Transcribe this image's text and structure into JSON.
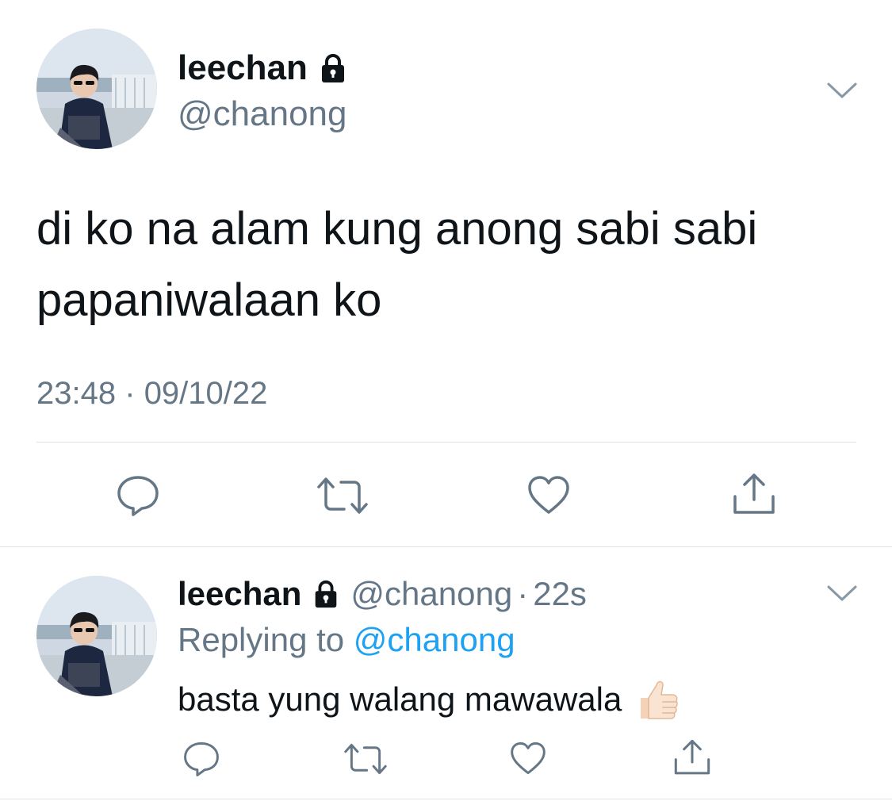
{
  "main_tweet": {
    "display_name": "leechan",
    "handle": "@chanong",
    "text": "di ko na alam kung anong sabi sabi papaniwalaan ko",
    "time": "23:48",
    "separator": "·",
    "date": "09/10/22",
    "icons": {
      "verified_lock": "lock-icon",
      "menu": "chevron-down-icon",
      "actions": [
        "reply-icon",
        "retweet-icon",
        "like-icon",
        "share-icon"
      ]
    }
  },
  "reply_tweet": {
    "display_name": "leechan",
    "handle": "@chanong",
    "separator": "·",
    "time_ago": "22s",
    "replying_prefix": "Replying to",
    "replying_handle": "@chanong",
    "text": "basta yung walang mawawala",
    "emoji": "thumbs-up-icon",
    "icons": {
      "menu": "chevron-down-icon",
      "actions": [
        "reply-icon",
        "retweet-icon",
        "like-icon",
        "share-icon"
      ]
    }
  },
  "colors": {
    "text_primary": "#0f1419",
    "text_secondary": "#657786",
    "link": "#1da1f2",
    "divider": "#dfe3e6"
  }
}
